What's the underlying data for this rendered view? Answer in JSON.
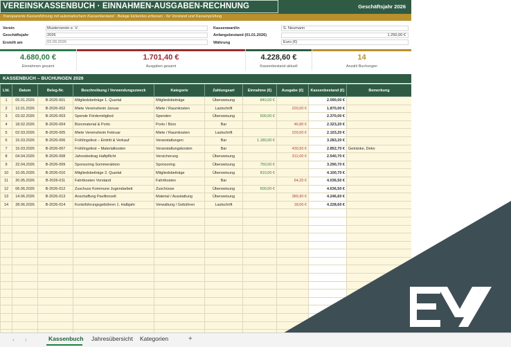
{
  "header": {
    "title": "VEREINSKASSENBUCH · EINNAHMEN-AUSGABEN-RECHNUNG",
    "fiscal_year_label": "Geschäftsjahr 2026",
    "subtitle": "Transparente Kassenführung mit automatischem Kassenbestand · Belege lückenlos erfassen · für Vorstand und Kassenprüfung"
  },
  "info": {
    "left": [
      {
        "label": "Verein",
        "value": "Musterverein e. V."
      },
      {
        "label": "Geschäftsjahr",
        "value": "2026"
      },
      {
        "label": "Erstellt am",
        "value": "02.09.2026"
      }
    ],
    "right": [
      {
        "label": "Kassenwart/in",
        "value": "S. Neumann"
      },
      {
        "label": "Anfangsbestand (01.01.2026)",
        "value": "1.250,00 €"
      },
      {
        "label": "Währung",
        "value": "Euro (€)"
      }
    ]
  },
  "kpis": [
    {
      "value": "4.680,00 €",
      "label": "Einnahmen gesamt",
      "color": "#2f7a4a",
      "accent": "#2f7a4a"
    },
    {
      "value": "1.701,40 €",
      "label": "Ausgaben gesamt",
      "color": "#9b2c2c",
      "accent": "#9b2c2c"
    },
    {
      "value": "4.228,60 €",
      "label": "Kassenbestand aktuell",
      "color": "#2a2a2a",
      "accent": "#2f5b45"
    },
    {
      "value": "14",
      "label": "Anzahl Buchungen",
      "color": "#b8902c",
      "accent": "#b8902c"
    }
  ],
  "section_title": "KASSENBUCH – BUCHUNGEN 2026",
  "table": {
    "columns": [
      "Lfd.",
      "Datum",
      "Beleg-Nr.",
      "Beschreibung / Verwendungszweck",
      "Kategorie",
      "Zahlungsart",
      "Einnahme (€)",
      "Ausgabe (€)",
      "Kassenbestand (€)",
      "Bemerkung"
    ],
    "rows": [
      [
        "1",
        "05.01.2026",
        "B-2026-001",
        "Mitgliedsbeiträge 1. Quartal",
        "Mitgliedsbeiträge",
        "Überweisung",
        "840,00 €",
        "",
        "2.090,00 €",
        ""
      ],
      [
        "2",
        "12.01.2026",
        "B-2026-002",
        "Miete Vereinsheim Januar",
        "Miete / Raumkosten",
        "Lastschrift",
        "",
        "220,00 €",
        "1.870,00 €",
        ""
      ],
      [
        "3",
        "03.02.2026",
        "B-2026-003",
        "Spende Fördermitglied",
        "Spenden",
        "Überweisung",
        "500,00 €",
        "",
        "2.370,00 €",
        ""
      ],
      [
        "4",
        "18.02.2026",
        "B-2026-004",
        "Büromaterial & Porto",
        "Porto / Büro",
        "Bar",
        "",
        "46,80 €",
        "2.323,20 €",
        ""
      ],
      [
        "5",
        "02.03.2026",
        "B-2026-005",
        "Miete Vereinsheim Februar",
        "Miete / Raumkosten",
        "Lastschrift",
        "",
        "220,00 €",
        "2.103,20 €",
        ""
      ],
      [
        "6",
        "15.03.2026",
        "B-2026-006",
        "Frühlingsfest – Eintritt & Verkauf",
        "Veranstaltungen",
        "Bar",
        "1.180,00 €",
        "",
        "3.283,20 €",
        ""
      ],
      [
        "7",
        "15.03.2026",
        "B-2026-007",
        "Frühlingsfest – Materialkosten",
        "Veranstaltungskosten",
        "Bar",
        "",
        "430,50 €",
        "2.852,70 €",
        "Getränke, Deko"
      ],
      [
        "8",
        "04.04.2026",
        "B-2026-008",
        "Jahresbeitrag Haftpflicht",
        "Versicherung",
        "Überweisung",
        "",
        "312,00 €",
        "2.540,70 €",
        ""
      ],
      [
        "9",
        "22.04.2026",
        "B-2026-009",
        "Sponsoring Sommeraktion",
        "Sponsoring",
        "Überweisung",
        "750,00 €",
        "",
        "3.290,70 €",
        ""
      ],
      [
        "10",
        "10.05.2026",
        "B-2026-010",
        "Mitgliedsbeiträge 2. Quartal",
        "Mitgliedsbeiträge",
        "Überweisung",
        "810,00 €",
        "",
        "4.100,70 €",
        ""
      ],
      [
        "11",
        "20.05.2026",
        "B-2026-011",
        "Fahrtkosten Vorstand",
        "Fahrtkosten",
        "Bar",
        "",
        "64,20 €",
        "4.036,50 €",
        ""
      ],
      [
        "12",
        "06.06.2026",
        "B-2026-012",
        "Zuschuss Kommune Jugendarbeit",
        "Zuschüsse",
        "Überweisung",
        "600,00 €",
        "",
        "4.636,50 €",
        ""
      ],
      [
        "13",
        "14.06.2026",
        "B-2026-013",
        "Anschaffung Pavillonzelt",
        "Material / Ausstattung",
        "Überweisung",
        "",
        "389,90 €",
        "4.246,60 €",
        ""
      ],
      [
        "14",
        "28.06.2026",
        "B-2026-014",
        "Kontoführungsgebühren 1. Halbjahr",
        "Verwaltung / Gebühren",
        "Lastschrift",
        "",
        "18,00 €",
        "4.228,60 €",
        ""
      ]
    ],
    "empty_rows": 16
  },
  "tabs": {
    "items": [
      "Kassenbuch",
      "Jahresübersicht",
      "Kategorien"
    ],
    "active": "Kassenbuch",
    "add": "+",
    "nav_prev": "‹",
    "nav_next": "›"
  },
  "colors": {
    "header_green": "#2f5b45",
    "accent_gold": "#b8902c",
    "row_cream": "#fdf7de",
    "income_green": "#2f7a2f",
    "expense_red": "#b03a2e",
    "brand_slate": "#3e4e55"
  },
  "brand": {
    "icon": "ex-logo-icon"
  }
}
